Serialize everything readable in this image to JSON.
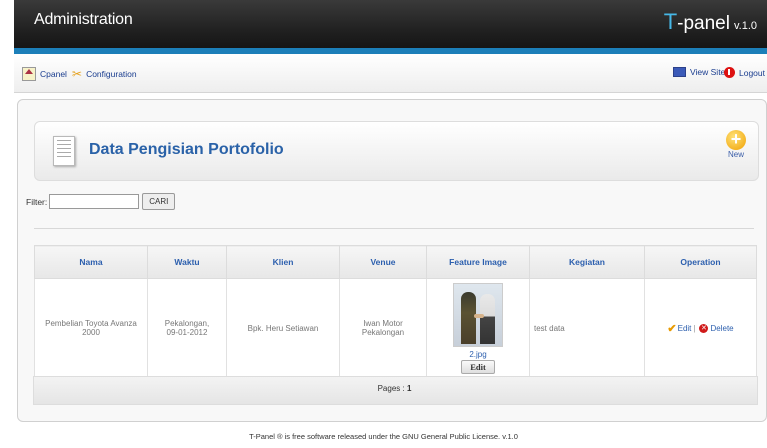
{
  "header": {
    "title": "Administration",
    "brand_t": "T",
    "brand_rest": "-panel",
    "version": "v.1.0"
  },
  "toolbar": {
    "cpanel": "Cpanel",
    "configuration": "Configuration",
    "view_site": "View Site",
    "logout": "Logout"
  },
  "page": {
    "title": "Data Pengisian Portofolio",
    "new_label": "New"
  },
  "filter": {
    "label": "Filter:",
    "value": "",
    "button": "CARI"
  },
  "table": {
    "headers": [
      "Nama",
      "Waktu",
      "Klien",
      "Venue",
      "Feature Image",
      "Kegiatan",
      "Operation"
    ],
    "rows": [
      {
        "nama": "Pembelian Toyota Avanza 2000",
        "waktu_place": "Pekalongan,",
        "waktu_date": "09-01-2012",
        "klien": "Bpk. Heru Setiawan",
        "venue": "Iwan Motor Pekalongan",
        "image_file": "2.jpg",
        "image_edit": "Edit",
        "kegiatan": "test data",
        "op_edit": "Edit",
        "op_sep": "|",
        "op_delete": "Delete"
      }
    ]
  },
  "pagination": {
    "label": "Pages :",
    "current": "1"
  },
  "footer": {
    "text": "T-Panel ® is free software released under the GNU General Public License.   v.1.0"
  },
  "colors": {
    "header_bg": "#1e1e1e",
    "accent_blue": "#1c7fb9",
    "link_blue": "#2c5fae"
  }
}
